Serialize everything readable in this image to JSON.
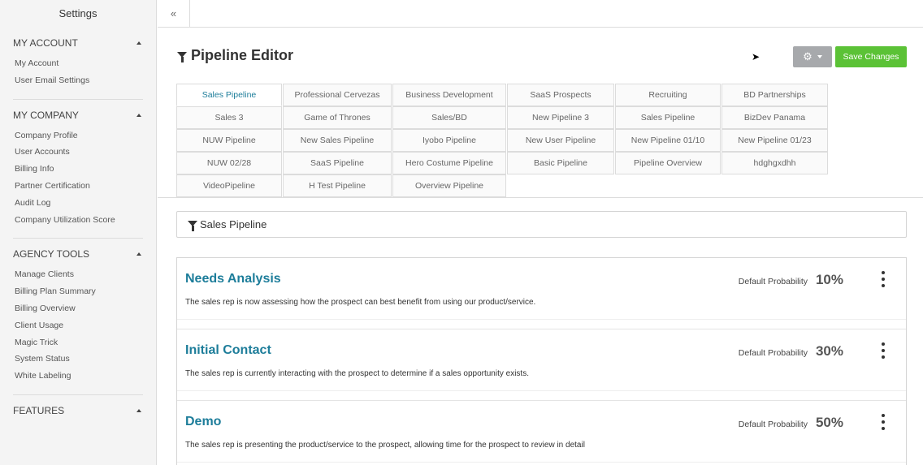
{
  "sidebar": {
    "title": "Settings",
    "sections": [
      {
        "heading": "MY ACCOUNT",
        "items": [
          "My Account",
          "User Email Settings"
        ]
      },
      {
        "heading": "MY COMPANY",
        "items": [
          "Company Profile",
          "User Accounts",
          "Billing Info",
          "Partner Certification",
          "Audit Log",
          "Company Utilization Score"
        ]
      },
      {
        "heading": "AGENCY TOOLS",
        "items": [
          "Manage Clients",
          "Billing Plan Summary",
          "Billing Overview",
          "Client Usage",
          "Magic Trick",
          "System Status",
          "White Labeling"
        ]
      },
      {
        "heading": "FEATURES",
        "items": []
      }
    ]
  },
  "topbar": {
    "collapse_icon": "«"
  },
  "header": {
    "title": "Pipeline Editor",
    "save_label": "Save Changes",
    "gear_icon": "⚙"
  },
  "tabs": [
    "Sales Pipeline",
    "Professional Cervezas",
    "Business Development",
    "SaaS Prospects",
    "Recruiting",
    "BD Partnerships",
    "Sales 3",
    "Game of Thrones",
    "Sales/BD",
    "New Pipeline 3",
    "Sales Pipeline",
    "BizDev Panama",
    "NUW Pipeline",
    "New Sales Pipeline",
    "Iyobo Pipeline",
    "New User Pipeline",
    "New Pipeline 01/10",
    "New Pipeline 01/23",
    "NUW 02/28",
    "SaaS Pipeline",
    "Hero Costume Pipeline",
    "Basic Pipeline",
    "Pipeline Overview",
    "hdghgxdhh",
    "VideoPipeline",
    "H Test Pipeline",
    "Overview Pipeline"
  ],
  "active_tab": "Sales Pipeline",
  "pipeline": {
    "name": "Sales Pipeline",
    "probability_label": "Default Probability",
    "stages": [
      {
        "name": "Needs Analysis",
        "probability": "10%",
        "description": "The sales rep is now assessing how the prospect can best benefit from using our product/service."
      },
      {
        "name": "Initial Contact",
        "probability": "30%",
        "description": "The sales rep is currently interacting with the prospect to determine if a sales opportunity exists."
      },
      {
        "name": "Demo",
        "probability": "50%",
        "description": "The sales rep is presenting the product/service to the prospect, allowing time for the prospect to review in detail"
      }
    ]
  }
}
